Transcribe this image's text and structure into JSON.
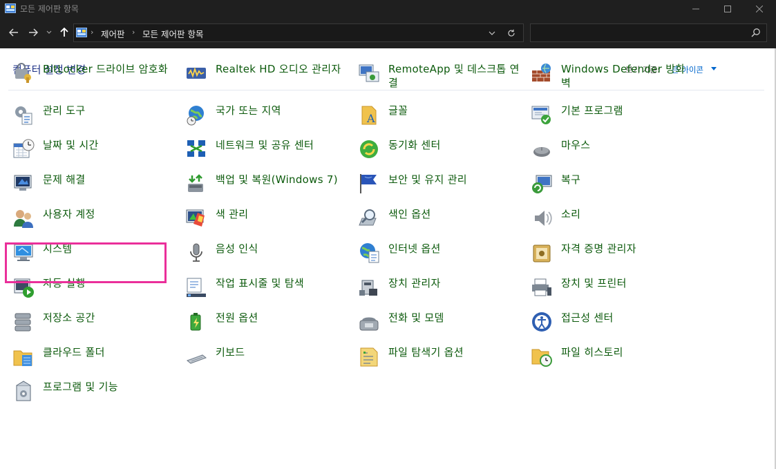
{
  "window": {
    "title": "모든 제어판 항목",
    "colors": {
      "chrome": "#1f1f1f",
      "link": "#0c5a0c",
      "title": "#1e3287",
      "highlight": "#ea2f9a"
    }
  },
  "navbar": {
    "breadcrumbs": [
      "제어판",
      "모든 제어판 항목"
    ],
    "search_placeholder": ""
  },
  "header": {
    "title": "컴퓨터 설정 변경",
    "view_by_label": "보기 기준:",
    "view_by_value": "큰 아이콘"
  },
  "items": [
    {
      "label": "BitLocker 드라이브 암호화",
      "icon": "bitlocker-icon"
    },
    {
      "label": "Realtek HD 오디오 관리자",
      "icon": "realtek-audio-icon"
    },
    {
      "label": "RemoteApp 및 데스크톱 연결",
      "icon": "remoteapp-icon"
    },
    {
      "label": "Windows Defender 방화벽",
      "icon": "firewall-icon"
    },
    {
      "label": "관리 도구",
      "icon": "admin-tools-icon"
    },
    {
      "label": "국가 또는 지역",
      "icon": "region-icon"
    },
    {
      "label": "글꼴",
      "icon": "fonts-icon"
    },
    {
      "label": "기본 프로그램",
      "icon": "default-programs-icon"
    },
    {
      "label": "날짜 및 시간",
      "icon": "date-time-icon"
    },
    {
      "label": "네트워크 및 공유 센터",
      "icon": "network-icon"
    },
    {
      "label": "동기화 센터",
      "icon": "sync-center-icon"
    },
    {
      "label": "마우스",
      "icon": "mouse-icon"
    },
    {
      "label": "문제 해결",
      "icon": "troubleshooting-icon"
    },
    {
      "label": "백업 및 복원(Windows 7)",
      "icon": "backup-restore-icon"
    },
    {
      "label": "보안 및 유지 관리",
      "icon": "security-maintenance-icon"
    },
    {
      "label": "복구",
      "icon": "recovery-icon"
    },
    {
      "label": "사용자 계정",
      "icon": "user-accounts-icon"
    },
    {
      "label": "색 관리",
      "icon": "color-management-icon"
    },
    {
      "label": "색인 옵션",
      "icon": "indexing-options-icon"
    },
    {
      "label": "소리",
      "icon": "sound-icon"
    },
    {
      "label": "시스템",
      "icon": "system-icon"
    },
    {
      "label": "음성 인식",
      "icon": "speech-recognition-icon"
    },
    {
      "label": "인터넷 옵션",
      "icon": "internet-options-icon"
    },
    {
      "label": "자격 증명 관리자",
      "icon": "credential-manager-icon"
    },
    {
      "label": "자동 실행",
      "icon": "autoplay-icon"
    },
    {
      "label": "작업 표시줄 및 탐색",
      "icon": "taskbar-icon"
    },
    {
      "label": "장치 관리자",
      "icon": "device-manager-icon"
    },
    {
      "label": "장치 및 프린터",
      "icon": "devices-printers-icon"
    },
    {
      "label": "저장소 공간",
      "icon": "storage-spaces-icon"
    },
    {
      "label": "전원 옵션",
      "icon": "power-options-icon"
    },
    {
      "label": "전화 및 모뎀",
      "icon": "phone-modem-icon"
    },
    {
      "label": "접근성 센터",
      "icon": "ease-of-access-icon"
    },
    {
      "label": "클라우드 폴더",
      "icon": "work-folders-icon"
    },
    {
      "label": "키보드",
      "icon": "keyboard-icon"
    },
    {
      "label": "파일 탐색기 옵션",
      "icon": "file-explorer-options-icon"
    },
    {
      "label": "파일 히스토리",
      "icon": "file-history-icon"
    },
    {
      "label": "프로그램 및 기능",
      "icon": "programs-features-icon"
    }
  ],
  "highlighted_item": "사용자 계정"
}
